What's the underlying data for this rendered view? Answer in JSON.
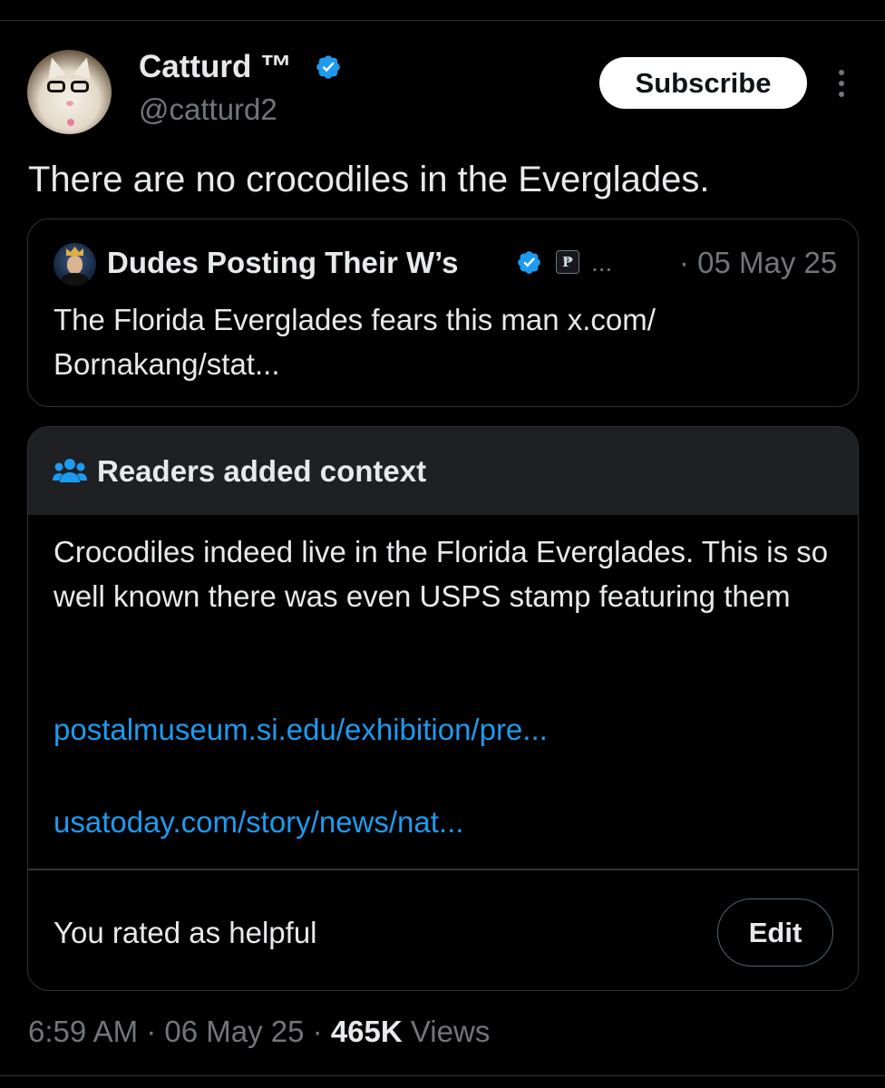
{
  "author": {
    "display_name": "Catturd ™",
    "handle": "@catturd2",
    "verified": true
  },
  "subscribe_label": "Subscribe",
  "tweet_text": "There are no crocodiles in the Everglades.",
  "quote": {
    "display_name": "Dudes Posting Their W’s",
    "verified": true,
    "affiliate_badge": "₱",
    "ellipsis": "...",
    "date": "· 05 May 25",
    "text": "The Florida Everglades fears this man x.com/ Bornakang/stat..."
  },
  "note": {
    "title": "Readers added context",
    "body": "Crocodiles indeed live in the Florida Everglades. This is so well known there was even USPS stamp featuring them",
    "links": [
      "postalmuseum.si.edu/exhibition/pre...",
      "usatoday.com/story/news/nat..."
    ],
    "rated_text": "You rated as helpful",
    "edit_label": "Edit"
  },
  "footer": {
    "time": "6:59 AM",
    "sep1": " · ",
    "date": "06 May 25",
    "sep2": " · ",
    "views_count": "465K",
    "views_label": " Views"
  },
  "colors": {
    "background": "#000000",
    "text": "#e7e9ea",
    "secondary": "#71767b",
    "link": "#1d9bf0",
    "verified": "#1d9bf0",
    "border": "#2f3336",
    "note_header_bg": "#1e2024"
  },
  "icons": {
    "verified": "verified-badge-icon",
    "more": "more-options-icon",
    "people": "people-icon"
  }
}
